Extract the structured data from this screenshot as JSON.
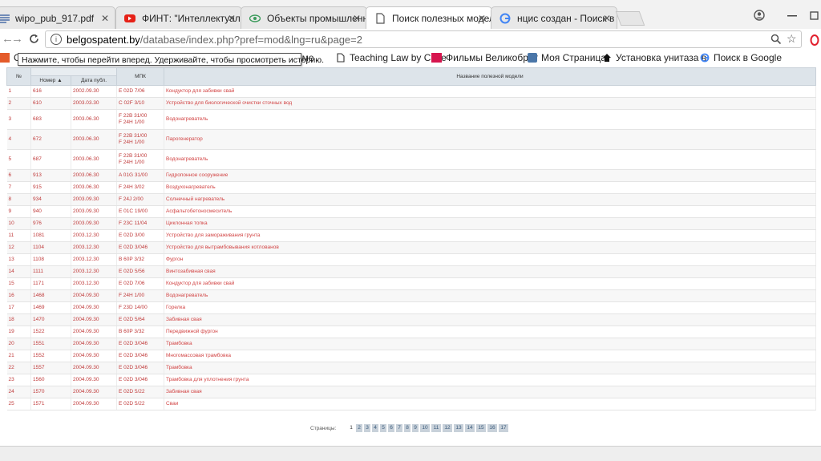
{
  "browser": {
    "tabs": [
      {
        "label": "wipo_pub_917.pdf",
        "icon": "document-lines-icon"
      },
      {
        "label": "ФИНТ: \"Интеллектуаль...",
        "icon": "youtube-icon"
      },
      {
        "label": "Объекты промышленн...",
        "icon": "eye-icon"
      },
      {
        "label": "Поиск полезных модел...",
        "icon": "page-icon"
      },
      {
        "label": "нцис создан - Поиск в G",
        "icon": "google-icon"
      }
    ],
    "close_glyph": "✕",
    "url_domain": "belgospatent.by",
    "url_path": "/database/index.php?pref=mod&lng=ru&page=2",
    "bookmarks": [
      {
        "label": "Се",
        "icon": "bookmark-apps-icon"
      },
      {
        "label": "на теме",
        "icon": ""
      },
      {
        "label": "Teaching Law by Case",
        "icon": "page-icon"
      },
      {
        "label": "Фильмы Великобрит",
        "icon": "ivi-icon"
      },
      {
        "label": "Моя Страница",
        "icon": "vk-icon"
      },
      {
        "label": "Установка унитаза в",
        "icon": "house-icon"
      },
      {
        "label": "Поиск в Google",
        "icon": "google-icon"
      }
    ],
    "tooltip": "Нажмите, чтобы перейти вперед. Удерживайте, чтобы просмотреть историю."
  },
  "table": {
    "headers": {
      "idx": "№",
      "number": "Номер ▲",
      "date": "Дата публ.",
      "ipc": "МПК",
      "name": "Название полезной модели"
    },
    "rows": [
      {
        "n": "1",
        "num": "616",
        "date": "2002.09.30",
        "ipc": [
          "E 02D 7/06"
        ],
        "name": "Кондуктор для забивки свай"
      },
      {
        "n": "2",
        "num": "610",
        "date": "2003.03.30",
        "ipc": [
          "C 02F 3/10"
        ],
        "name": "Устройство для биологической очистки сточных вод"
      },
      {
        "n": "3",
        "num": "683",
        "date": "2003.06.30",
        "ipc": [
          "F 22B 31/00",
          "F 24H 1/00"
        ],
        "name": "Водонагреватель"
      },
      {
        "n": "4",
        "num": "672",
        "date": "2003.06.30",
        "ipc": [
          "F 22B 31/00",
          "F 24H 1/00"
        ],
        "name": "Парогенератор"
      },
      {
        "n": "5",
        "num": "687",
        "date": "2003.06.30",
        "ipc": [
          "F 22B 31/00",
          "F 24H 1/00"
        ],
        "name": "Водонагреватель"
      },
      {
        "n": "6",
        "num": "913",
        "date": "2003.06.30",
        "ipc": [
          "A 01G 31/00"
        ],
        "name": "Гидропонное сооружение"
      },
      {
        "n": "7",
        "num": "915",
        "date": "2003.06.30",
        "ipc": [
          "F 24H 3/02"
        ],
        "name": "Воздухонагреватель"
      },
      {
        "n": "8",
        "num": "934",
        "date": "2003.09.30",
        "ipc": [
          "F 24J 2/00"
        ],
        "name": "Солнечный нагреватель"
      },
      {
        "n": "9",
        "num": "940",
        "date": "2003.09.30",
        "ipc": [
          "E 01C 19/00"
        ],
        "name": "Асфальтобетоносмеситель"
      },
      {
        "n": "10",
        "num": "976",
        "date": "2003.09.30",
        "ipc": [
          "F 23C 11/04"
        ],
        "name": "Циклонная топка"
      },
      {
        "n": "11",
        "num": "1081",
        "date": "2003.12.30",
        "ipc": [
          "E 02D 3/00"
        ],
        "name": "Устройство для замораживания грунта"
      },
      {
        "n": "12",
        "num": "1104",
        "date": "2003.12.30",
        "ipc": [
          "E 02D 3/046"
        ],
        "name": "Устройство для вытрамбовывания котлованов"
      },
      {
        "n": "13",
        "num": "1108",
        "date": "2003.12.30",
        "ipc": [
          "B 60P 3/32"
        ],
        "name": "Фургон"
      },
      {
        "n": "14",
        "num": "1111",
        "date": "2003.12.30",
        "ipc": [
          "E 02D 5/56"
        ],
        "name": "Винтозабивная свая"
      },
      {
        "n": "15",
        "num": "1171",
        "date": "2003.12.30",
        "ipc": [
          "E 02D 7/06"
        ],
        "name": "Кондуктор для забивки свай"
      },
      {
        "n": "16",
        "num": "1468",
        "date": "2004.09.30",
        "ipc": [
          "F 24H 1/00"
        ],
        "name": "Водонагреватель"
      },
      {
        "n": "17",
        "num": "1469",
        "date": "2004.09.30",
        "ipc": [
          "F 23D 14/00"
        ],
        "name": "Горелка"
      },
      {
        "n": "18",
        "num": "1470",
        "date": "2004.09.30",
        "ipc": [
          "E 02D 5/64"
        ],
        "name": "Забивная свая"
      },
      {
        "n": "19",
        "num": "1522",
        "date": "2004.09.30",
        "ipc": [
          "B 60P 3/32"
        ],
        "name": "Передвижной фургон"
      },
      {
        "n": "20",
        "num": "1551",
        "date": "2004.09.30",
        "ipc": [
          "E 02D 3/046"
        ],
        "name": "Трамбовка"
      },
      {
        "n": "21",
        "num": "1552",
        "date": "2004.09.30",
        "ipc": [
          "E 02D 3/046"
        ],
        "name": "Многомассовая трамбовка"
      },
      {
        "n": "22",
        "num": "1557",
        "date": "2004.09.30",
        "ipc": [
          "E 02D 3/046"
        ],
        "name": "Трамбовка"
      },
      {
        "n": "23",
        "num": "1560",
        "date": "2004.09.30",
        "ipc": [
          "E 02D 3/046"
        ],
        "name": "Трамбовка для уплотнения грунта"
      },
      {
        "n": "24",
        "num": "1570",
        "date": "2004.09.30",
        "ipc": [
          "E 02D 5/22"
        ],
        "name": "Забивная свая"
      },
      {
        "n": "25",
        "num": "1571",
        "date": "2004.09.30",
        "ipc": [
          "E 02D 5/22"
        ],
        "name": "Сваи"
      }
    ]
  },
  "pager": {
    "label": "Страницы:",
    "current": "1",
    "pages": [
      "2",
      "3",
      "4",
      "5",
      "6",
      "7",
      "8",
      "9",
      "10",
      "11",
      "12",
      "13",
      "14",
      "15",
      "16",
      "17"
    ]
  },
  "colors": {
    "link_red": "#c03a3a",
    "header_bg": "#dde4ea",
    "pager_bg": "#c8d1da"
  }
}
